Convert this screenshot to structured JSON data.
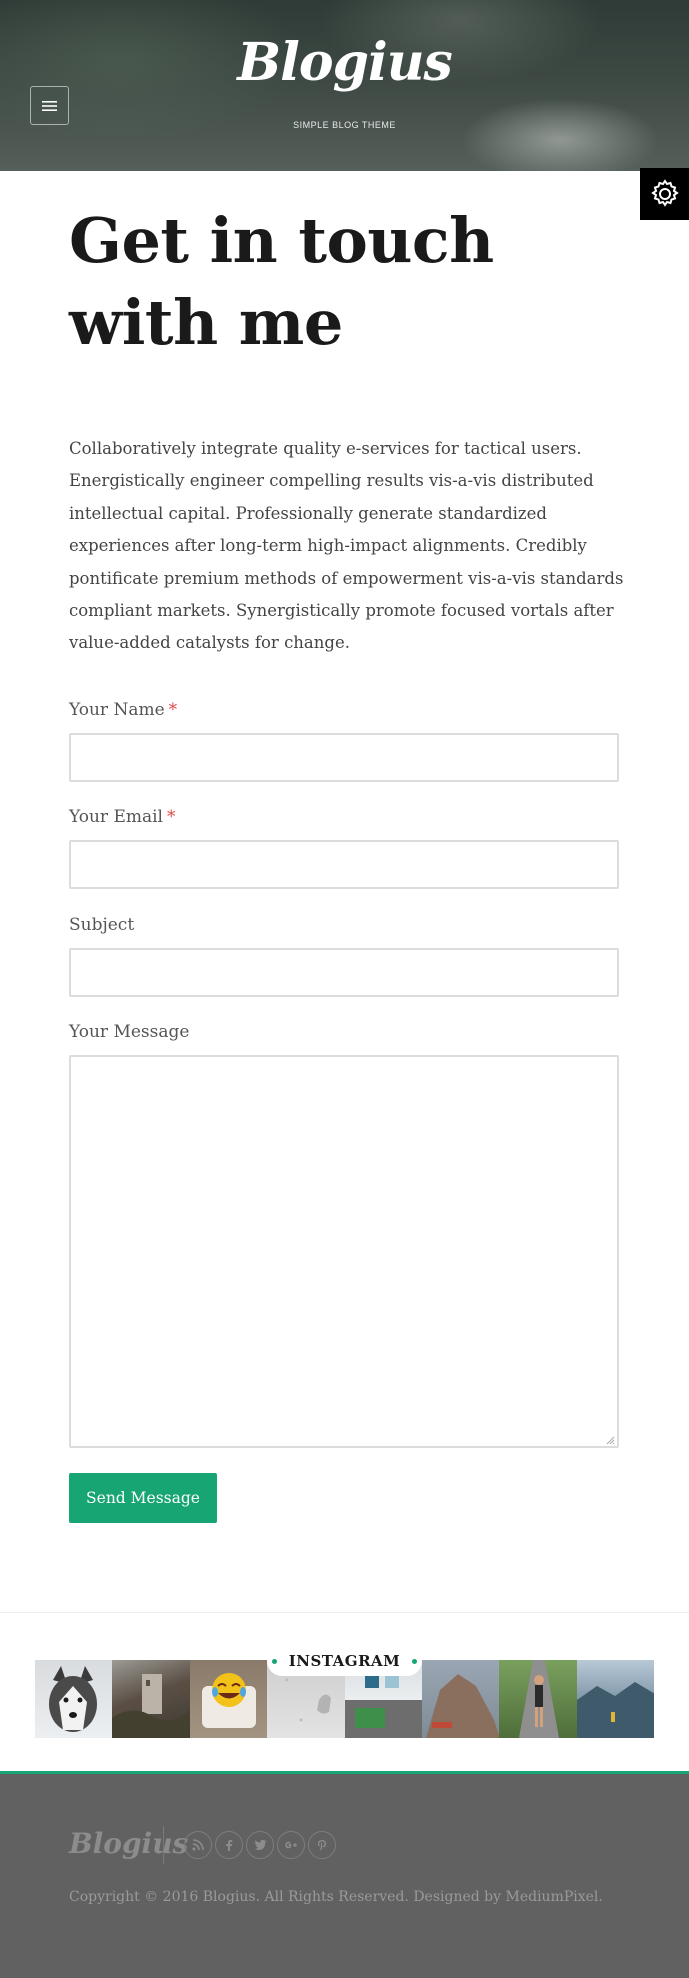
{
  "header": {
    "logo": "Blogius",
    "tagline": "SIMPLE BLOG THEME",
    "menu_icon": "hamburger-menu-icon",
    "settings_icon": "gear-icon"
  },
  "main": {
    "title": "Get in touch with me",
    "intro": "Collaboratively integrate quality e-services for tactical users. Energistically engineer compelling results vis-a-vis distributed intellectual capital. Professionally generate standardized experiences after long-term high-impact alignments. Credibly pontificate premium methods of empowerment vis-a-vis standards compliant markets. Synergistically promote focused vortals after value-added catalysts for change."
  },
  "form": {
    "name_label": "Your Name",
    "name_value": "",
    "email_label": "Your Email",
    "email_value": "",
    "subject_label": "Subject",
    "subject_value": "",
    "message_label": "Your Message",
    "message_value": "",
    "required_marker": "*",
    "submit_label": "Send Message"
  },
  "instagram": {
    "title": "INSTAGRAM",
    "photos": [
      "husky-dog",
      "castle-ruins",
      "laughing-emoji-pillow",
      "snow-bird",
      "street-art",
      "rock-formation",
      "runner-on-road",
      "mountain-fjord"
    ]
  },
  "footer": {
    "logo": "Blogius",
    "social_icons": [
      "rss-icon",
      "facebook-icon",
      "twitter-icon",
      "google-plus-icon",
      "pinterest-icon"
    ],
    "copyright": "Copyright © 2016 Blogius. All Rights Reserved. Designed by MediumPixel."
  },
  "colors": {
    "accent": "#17a673",
    "footer_bg": "#616161",
    "required": "#e04b4b"
  }
}
